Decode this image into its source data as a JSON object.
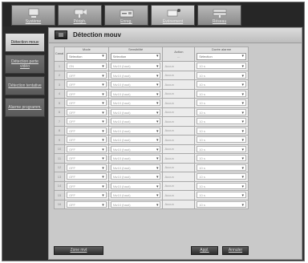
{
  "top_tabs": [
    {
      "label": "Système",
      "icon": "monitor-icon"
    },
    {
      "label": "Périph.",
      "icon": "camera-icon"
    },
    {
      "label": "Enreg.",
      "icon": "recorder-icon"
    },
    {
      "label": "Événement",
      "icon": "event-icon"
    },
    {
      "label": "Réseau",
      "icon": "network-icon"
    }
  ],
  "sidebar": {
    "items": [
      {
        "label": "Détection mouv"
      },
      {
        "label": "Détection perte vidéo"
      },
      {
        "label": "Détection tentative"
      },
      {
        "label": "Alarme programm."
      }
    ]
  },
  "page": {
    "title": "Détection mouv"
  },
  "table": {
    "columns": {
      "index": "Canal",
      "mode": "Mode",
      "sensitivity": "Sensibilité",
      "action": "Action",
      "duration": "Durée alarme"
    },
    "header_values": {
      "mode": "Sélection",
      "sensitivity": "Sélection",
      "duration": "Sélection"
    },
    "rows": [
      {
        "ch": "1",
        "mode": "ON",
        "sensitivity": "Niv10 (haut)",
        "action": "Aucun",
        "duration": "10 s"
      },
      {
        "ch": "2",
        "mode": "OFF",
        "sensitivity": "Niv10 (haut)",
        "action": "Aucun",
        "duration": "10 s"
      },
      {
        "ch": "3",
        "mode": "OFF",
        "sensitivity": "Niv10 (haut)",
        "action": "Aucun",
        "duration": "10 s"
      },
      {
        "ch": "4",
        "mode": "OFF",
        "sensitivity": "Niv10 (haut)",
        "action": "Aucun",
        "duration": "10 s"
      },
      {
        "ch": "5",
        "mode": "OFF",
        "sensitivity": "Niv10 (haut)",
        "action": "Aucun",
        "duration": "10 s"
      },
      {
        "ch": "6",
        "mode": "OFF",
        "sensitivity": "Niv10 (haut)",
        "action": "Aucun",
        "duration": "10 s"
      },
      {
        "ch": "7",
        "mode": "OFF",
        "sensitivity": "Niv10 (haut)",
        "action": "Aucun",
        "duration": "10 s"
      },
      {
        "ch": "8",
        "mode": "OFF",
        "sensitivity": "Niv10 (haut)",
        "action": "Aucun",
        "duration": "10 s"
      },
      {
        "ch": "9",
        "mode": "OFF",
        "sensitivity": "Niv10 (haut)",
        "action": "Aucun",
        "duration": "10 s"
      },
      {
        "ch": "10",
        "mode": "OFF",
        "sensitivity": "Niv10 (haut)",
        "action": "Aucun",
        "duration": "10 s"
      },
      {
        "ch": "11",
        "mode": "OFF",
        "sensitivity": "Niv10 (haut)",
        "action": "Aucun",
        "duration": "10 s"
      },
      {
        "ch": "12",
        "mode": "OFF",
        "sensitivity": "Niv10 (haut)",
        "action": "Aucun",
        "duration": "10 s"
      },
      {
        "ch": "13",
        "mode": "OFF",
        "sensitivity": "Niv10 (haut)",
        "action": "Aucun",
        "duration": "10 s"
      },
      {
        "ch": "14",
        "mode": "OFF",
        "sensitivity": "Niv10 (haut)",
        "action": "Aucun",
        "duration": "10 s"
      },
      {
        "ch": "15",
        "mode": "OFF",
        "sensitivity": "Niv10 (haut)",
        "action": "Aucun",
        "duration": "10 s"
      },
      {
        "ch": "16",
        "mode": "OFF",
        "sensitivity": "Niv10 (haut)",
        "action": "Aucun",
        "duration": "10 s"
      }
    ]
  },
  "buttons": {
    "zone": "Zone mvt",
    "apply": "Appl.",
    "cancel": "Annuler"
  },
  "colors": {
    "frame": "#2f2f2f",
    "panel": "#c9c9c9",
    "active_tab": "#d7d7d7",
    "button": "#3a3a3a"
  }
}
